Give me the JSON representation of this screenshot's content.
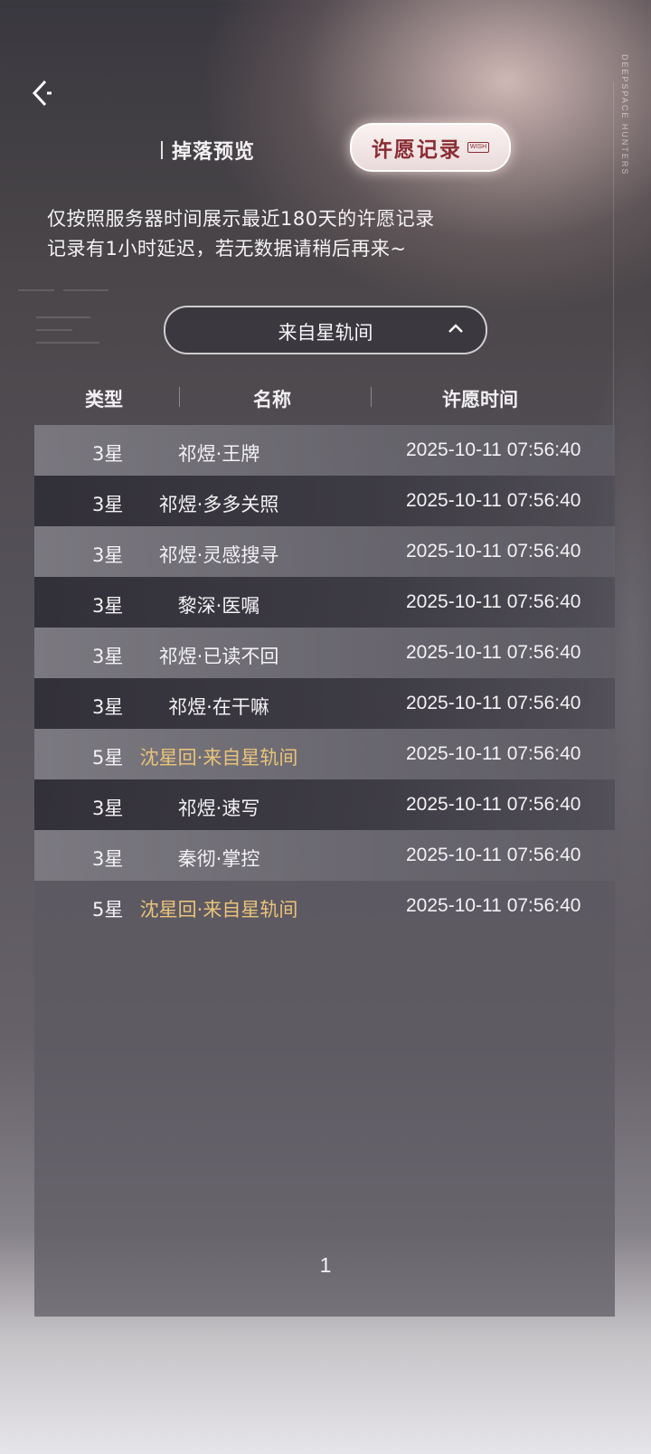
{
  "header": {
    "back_icon": "back-arrow-icon",
    "side_brand_text": "DEEPSPACE HUNTERS"
  },
  "tabs": {
    "drop_preview_label": "掉落预览",
    "wish_record_label": "许愿记录",
    "wish_record_tag": "WISH"
  },
  "notice": {
    "line1": "仅按照服务器时间展示最近180天的许愿记录",
    "line2": "记录有1小时延迟，若无数据请稍后再来~"
  },
  "pool_select": {
    "selected": "来自星轨间",
    "icon": "chevron-up-icon"
  },
  "table": {
    "headers": {
      "type": "类型",
      "name": "名称",
      "time": "许愿时间"
    },
    "rows": [
      {
        "type": "3星",
        "name": "祁煜·王牌",
        "time": "2025-10-11 07:56:40",
        "rarity": 3
      },
      {
        "type": "3星",
        "name": "祁煜·多多关照",
        "time": "2025-10-11 07:56:40",
        "rarity": 3
      },
      {
        "type": "3星",
        "name": "祁煜·灵感搜寻",
        "time": "2025-10-11 07:56:40",
        "rarity": 3
      },
      {
        "type": "3星",
        "name": "黎深·医嘱",
        "time": "2025-10-11 07:56:40",
        "rarity": 3
      },
      {
        "type": "3星",
        "name": "祁煜·已读不回",
        "time": "2025-10-11 07:56:40",
        "rarity": 3
      },
      {
        "type": "3星",
        "name": "祁煜·在干嘛",
        "time": "2025-10-11 07:56:40",
        "rarity": 3
      },
      {
        "type": "5星",
        "name": "沈星回·来自星轨间",
        "time": "2025-10-11 07:56:40",
        "rarity": 5
      },
      {
        "type": "3星",
        "name": "祁煜·速写",
        "time": "2025-10-11 07:56:40",
        "rarity": 3
      },
      {
        "type": "3星",
        "name": "秦彻·掌控",
        "time": "2025-10-11 07:56:40",
        "rarity": 3
      },
      {
        "type": "5星",
        "name": "沈星回·来自星轨间",
        "time": "2025-10-11 07:56:40",
        "rarity": 5
      }
    ]
  },
  "pagination": {
    "current_page": "1"
  },
  "colors": {
    "five_star_name": "#e9c37a",
    "wish_tab_text": "#8a2d34"
  }
}
